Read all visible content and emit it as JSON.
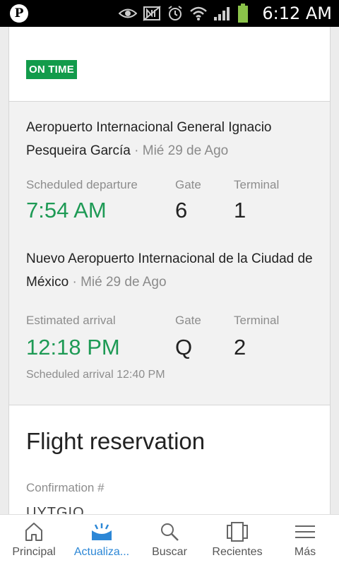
{
  "status_bar": {
    "time": "6:12 AM",
    "app_icon": "pinterest-icon",
    "app_icon_glyph": "P",
    "icons": [
      "eye-icon",
      "nfc-icon",
      "alarm-icon",
      "wifi-icon",
      "signal-icon",
      "battery-icon"
    ]
  },
  "flight_status": {
    "badge": "ON TIME",
    "badge_color": "#129b4b"
  },
  "departure": {
    "airport_name": "Aeropuerto Internacional General Ignacio Pesqueira García",
    "date": "· Mié 29 de Ago",
    "time_label": "Scheduled departure",
    "time": "7:54 AM",
    "gate_label": "Gate",
    "gate": "6",
    "terminal_label": "Terminal",
    "terminal": "1"
  },
  "arrival": {
    "airport_name": "Nuevo Aeropuerto Internacional de la Ciudad de México",
    "date": "· Mié 29 de Ago",
    "time_label": "Estimated arrival",
    "time": "12:18 PM",
    "gate_label": "Gate",
    "gate": "Q",
    "terminal_label": "Terminal",
    "terminal": "2",
    "scheduled_note": "Scheduled arrival 12:40 PM"
  },
  "reservation": {
    "title": "Flight reservation",
    "confirmation_label": "Confirmation #",
    "confirmation_value": "UYTGIO"
  },
  "colors": {
    "accent_green": "#1e9a55",
    "accent_blue": "#2c87d6"
  },
  "nav": {
    "items": [
      {
        "label": "Principal",
        "icon": "home-icon"
      },
      {
        "label": "Actualiza...",
        "icon": "updates-icon",
        "active": true
      },
      {
        "label": "Buscar",
        "icon": "search-icon"
      },
      {
        "label": "Recientes",
        "icon": "recents-icon"
      },
      {
        "label": "Más",
        "icon": "menu-icon"
      }
    ]
  }
}
